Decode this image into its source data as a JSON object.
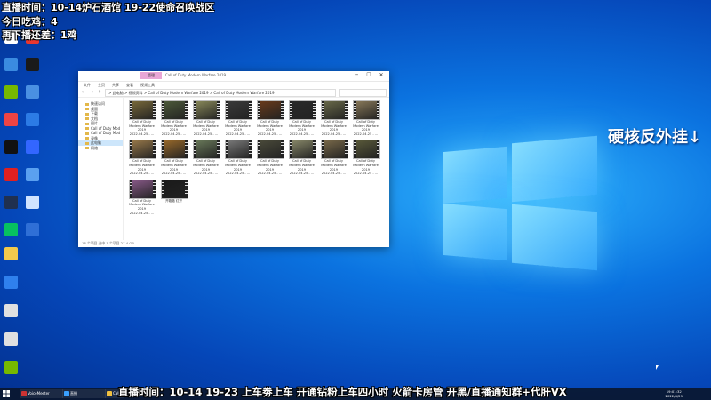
{
  "stream_overlay": {
    "line1": "直播时间：10-14炉石酒馆 19-22使命召唤战区",
    "line2": "今日吃鸡：4",
    "line3": "再下播还差：1鸡"
  },
  "side_banner": "硬核反外挂↓",
  "ticker": "直播时间：10-14 19-23 上车劵上车 开通钻粉上车四小时 火箭卡房管 开黑/直播通知群+代肝VX",
  "desktop_icons": [
    {
      "label": "",
      "color": "#ffffff"
    },
    {
      "label": "",
      "color": "#e8372f"
    },
    {
      "label": "",
      "color": "#3a8be0"
    },
    {
      "label": "",
      "color": "#1a1a1a"
    },
    {
      "label": "",
      "color": "#76b900"
    },
    {
      "label": "",
      "color": "#4a90e2"
    },
    {
      "label": "",
      "color": "#e44"
    },
    {
      "label": "",
      "color": "#2c7be5"
    },
    {
      "label": "",
      "color": "#111111"
    },
    {
      "label": "",
      "color": "#3366ff"
    },
    {
      "label": "",
      "color": "#e02020"
    },
    {
      "label": "",
      "color": "#5aa0f0"
    },
    {
      "label": "",
      "color": "#203050"
    },
    {
      "label": "",
      "color": "#d0e4ff"
    },
    {
      "label": "",
      "color": "#07c160"
    },
    {
      "label": "",
      "color": "#2f6fd6"
    },
    {
      "label": "",
      "color": "#f2c94c"
    },
    {
      "label": "",
      "color": "#2f80ed"
    },
    {
      "label": "",
      "color": "#e0e0e0"
    },
    {
      "label": "",
      "color": "#e0e0e0"
    },
    {
      "label": "",
      "color": "#76b900"
    }
  ],
  "explorer": {
    "tab_label": "管理",
    "title": "Call of Duty  Modern Warfare 2019",
    "ribbon": [
      "文件",
      "主页",
      "共享",
      "查看",
      "视频工具"
    ],
    "path": "> 此电脑 > 视频资料 > Call of Duty  Modern Warfare 2019 > Call of Duty  Modern Warfare 2019",
    "search_placeholder": "",
    "sidebar": [
      {
        "label": "快速访问",
        "selected": false
      },
      {
        "label": "桌面",
        "selected": false
      },
      {
        "label": "下载",
        "selected": false
      },
      {
        "label": "文档",
        "selected": false
      },
      {
        "label": "图片",
        "selected": false
      },
      {
        "label": "Call of Duty  Mod",
        "selected": false
      },
      {
        "label": "Call of Duty  Mod",
        "selected": false
      },
      {
        "label": "录像",
        "selected": false
      },
      {
        "label": "此电脑",
        "selected": true
      },
      {
        "label": "网络",
        "selected": false
      }
    ],
    "files": [
      {
        "name": "Call of Duty Modern Warfare 2019 2022.04.25 - ...",
        "tint": "#7a6a3a"
      },
      {
        "name": "Call of Duty Modern Warfare 2019 2022.04.25 - ...",
        "tint": "#4d5a3a"
      },
      {
        "name": "Call of Duty Modern Warfare 2019 2022.04.25 - ...",
        "tint": "#8a8a5a"
      },
      {
        "name": "Call of Duty Modern Warfare 2019 2022.04.25 - ...",
        "tint": "#3a3a3a"
      },
      {
        "name": "Call of Duty Modern Warfare 2019 2022.04.25 - ...",
        "tint": "#6a3a1a"
      },
      {
        "name": "Call of Duty Modern Warfare 2019 2022.04.25 - ...",
        "tint": "#2a2a2a"
      },
      {
        "name": "Call of Duty Modern Warfare 2019 2022.04.25 - ...",
        "tint": "#6a6a4a"
      },
      {
        "name": "Call of Duty Modern Warfare 2019 2022.04.25 - ...",
        "tint": "#8a7a5a"
      },
      {
        "name": "Call of Duty Modern Warfare 2019 2022.04.25 - ...",
        "tint": "#9a7a4a"
      },
      {
        "name": "Call of Duty Modern Warfare 2019 2022.04.25 - ...",
        "tint": "#9a6a2a"
      },
      {
        "name": "Call of Duty Modern Warfare 2019 2022.04.25 - ...",
        "tint": "#6a7a5a"
      },
      {
        "name": "Call of Duty Modern Warfare 2019 2022.04.25 - ...",
        "tint": "#7a7a7a"
      },
      {
        "name": "Call of Duty Modern Warfare 2019 2022.04.25 - ...",
        "tint": "#4a4a3a"
      },
      {
        "name": "Call of Duty Modern Warfare 2019 2022.04.25 - ...",
        "tint": "#8a8a6a"
      },
      {
        "name": "Call of Duty Modern Warfare 2019 2022.04.25 - ...",
        "tint": "#7a6a4a"
      },
      {
        "name": "Call of Duty Modern Warfare 2019 2022.04.25 - ...",
        "tint": "#5a5a3a"
      },
      {
        "name": "Call of Duty Modern Warfare 2019 2022.04.25 - ...",
        "tint": "#8a5a8a"
      },
      {
        "name": "开箱箱  红开",
        "tint": "#1a1a1a"
      }
    ],
    "status": "18 个项目     选中 1 个项目  27.4 GB"
  },
  "taskbar": {
    "items": [
      {
        "label": "VoiceMeeter",
        "color": "#cc3333"
      },
      {
        "label": "直播",
        "color": "#3aa0ff"
      },
      {
        "label": "Call",
        "color": "#f0c040"
      }
    ],
    "time": "19:01:32",
    "date": "2022/4/29"
  },
  "colors": {
    "desktop": "#0b73e0",
    "overlay_text": "#ffffff",
    "explorer_tab": "#e9a6d6",
    "selection": "#cde6fb"
  }
}
